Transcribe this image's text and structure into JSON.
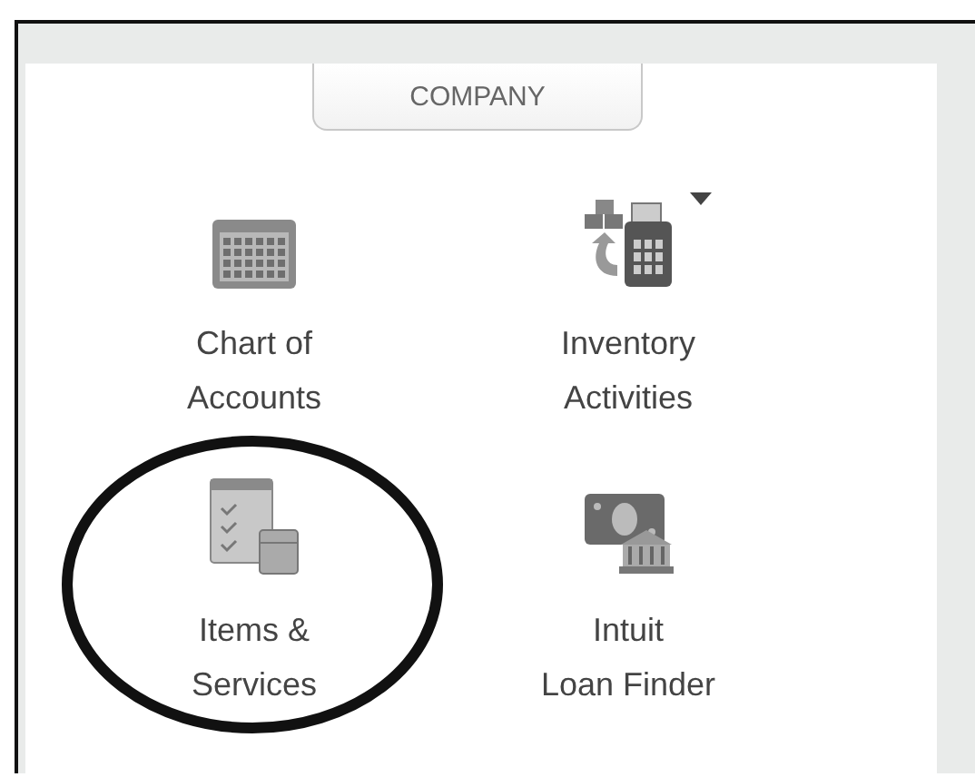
{
  "section_tab": {
    "label": "COMPANY"
  },
  "items": [
    {
      "kind": "chart",
      "label": "Chart of\nAccounts",
      "has_menu": false,
      "circled": false
    },
    {
      "kind": "inventory",
      "label": "Inventory\nActivities",
      "has_menu": true,
      "circled": false
    },
    {
      "kind": "items",
      "label": "Items &\nServices",
      "has_menu": false,
      "circled": true
    },
    {
      "kind": "loan",
      "label": "Intuit\nLoan Finder",
      "has_menu": false,
      "circled": false
    }
  ]
}
